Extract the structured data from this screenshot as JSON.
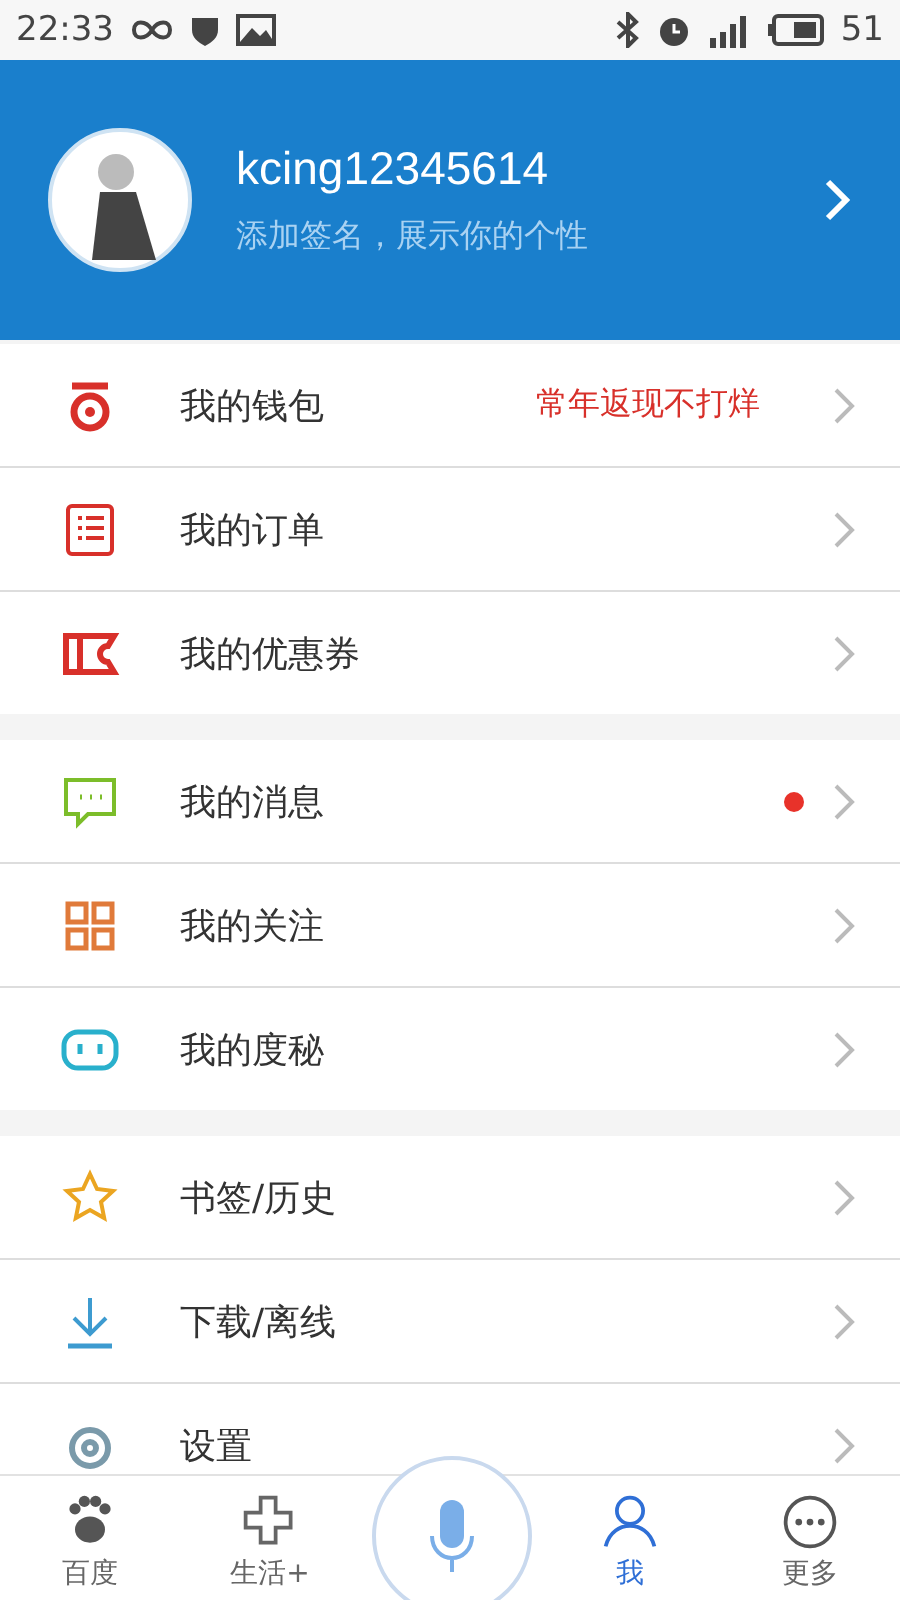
{
  "status_bar": {
    "time": "22:33",
    "battery": "51"
  },
  "profile": {
    "username": "kcing12345614",
    "signature": "添加签名，展示你的个性"
  },
  "groups": [
    {
      "items": [
        {
          "label": "我的钱包",
          "note": "常年返现不打烊",
          "unread": false
        },
        {
          "label": "我的订单",
          "unread": false
        },
        {
          "label": "我的优惠券",
          "unread": false
        }
      ]
    },
    {
      "items": [
        {
          "label": "我的消息",
          "unread": true
        },
        {
          "label": "我的关注",
          "unread": false
        },
        {
          "label": "我的度秘",
          "unread": false
        }
      ]
    },
    {
      "items": [
        {
          "label": "书签/历史",
          "unread": false
        },
        {
          "label": "下载/离线",
          "unread": false
        },
        {
          "label": "设置",
          "unread": false
        }
      ]
    }
  ],
  "tabs": [
    {
      "label": "百度",
      "selected": false
    },
    {
      "label": "生活+",
      "selected": false
    },
    {
      "kind": "voice",
      "selected": false
    },
    {
      "label": "我",
      "selected": true
    },
    {
      "label": "更多",
      "selected": false
    }
  ]
}
